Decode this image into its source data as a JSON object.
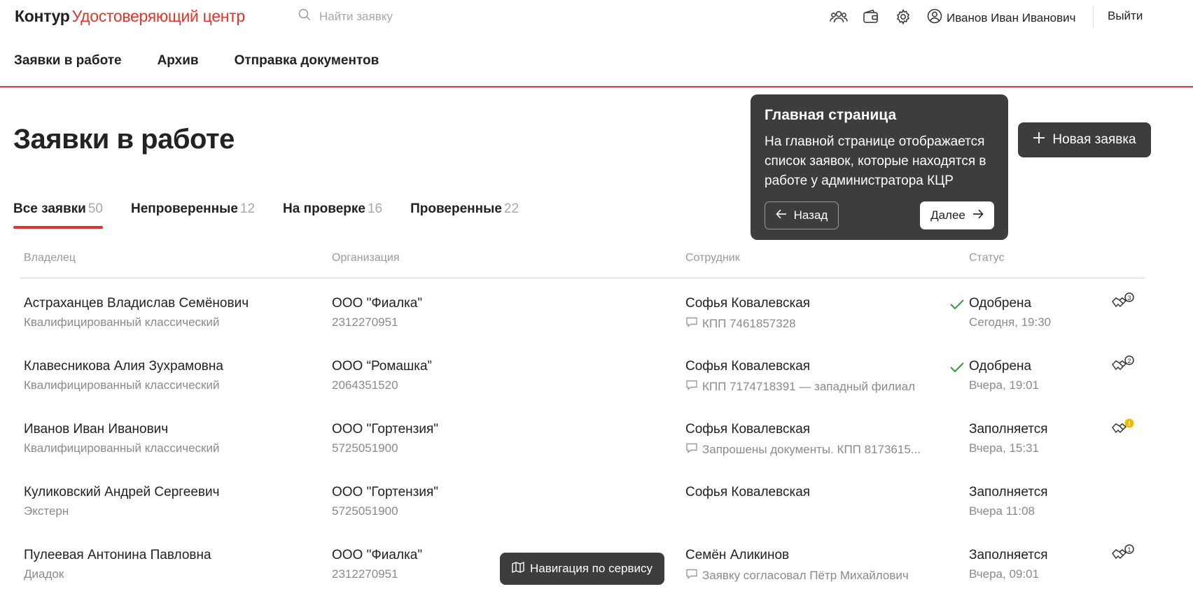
{
  "header": {
    "brand": "Контур",
    "product": "Удостоверяющий центр",
    "search_placeholder": "Найти заявку",
    "user_name": "Иванов Иван Иванович",
    "logout": "Выйти"
  },
  "nav": [
    "Заявки в работе",
    "Архив",
    "Отправка документов"
  ],
  "page_title": "Заявки в работе",
  "tabs": [
    {
      "label": "Все заявки",
      "count": "50"
    },
    {
      "label": "Непроверенные",
      "count": "12"
    },
    {
      "label": "На проверке",
      "count": "16"
    },
    {
      "label": "Проверенные",
      "count": "22"
    }
  ],
  "new_button": "Новая заявка",
  "tooltip": {
    "title": "Главная страница",
    "text": "На главной странице отображается список заявок, которые находятся в работе у администратора КЦР",
    "back": "Назад",
    "next": "Далее"
  },
  "columns": [
    "Владелец",
    "Организация",
    "Сотрудник",
    "Статус"
  ],
  "rows": [
    {
      "owner": "Астраханцев Владислав Семёнович",
      "type": "Квалифицированный классический",
      "org": "ООО \"Фиалка\"",
      "inn": "2312270951",
      "employee": "Софья Ковалевская",
      "note": "КПП 7461857328",
      "status": "Одобрена",
      "time": "Сегодня, 19:30",
      "badge": "3"
    },
    {
      "owner": "Клавесникова Алия Зухрамовна",
      "type": "Квалифицированный классический",
      "org": "ООО “Ромашка”",
      "inn": "2064351520",
      "employee": "Софья Ковалевская",
      "note": "КПП 7174718391 — западный филиал",
      "status": "Одобрена",
      "time": "Вчера, 19:01",
      "badge": "2"
    },
    {
      "owner": "Иванов Иван Иванович",
      "type": "Квалифицированный классический",
      "org": "ООО \"Гортензия\"",
      "inn": "5725051900",
      "employee": "Софья Ковалевская",
      "note": "Запрошены документы. КПП 8173615...",
      "status": "Заполняется",
      "time": "Вчера, 15:31",
      "badge": "!"
    },
    {
      "owner": "Куликовский Андрей Сергеевич",
      "type": "Экстерн",
      "org": "ООО \"Гортензия\"",
      "inn": "5725051900",
      "employee": "Софья Ковалевская",
      "note": "",
      "status": "Заполняется",
      "time": "Вчера 11:08",
      "badge": ""
    },
    {
      "owner": "Пулеевая Антонина Павловна",
      "type": "Диадок",
      "org": "ООО \"Фиалка\"",
      "inn": "2312270951",
      "employee": "Семён Аликинов",
      "note": "Заявку согласовал Пётр Михайлович",
      "status": "Заполняется",
      "time": "Вчера, 09:01",
      "badge": "1"
    }
  ],
  "nav_hint": "Навигация по сервису",
  "colors": {
    "accent": "#e6332a",
    "dark": "#3d3d3d",
    "warning": "#f5b800",
    "success": "#2e9a3c"
  }
}
